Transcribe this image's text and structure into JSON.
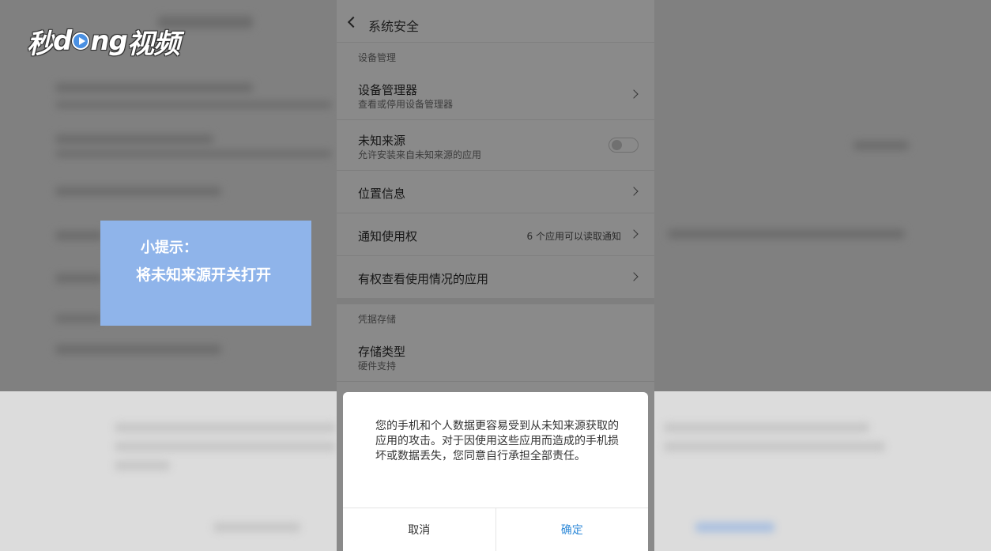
{
  "logo": {
    "prefix": "秒",
    "d": "d",
    "ng": "ng",
    "suffix": "视频"
  },
  "tip": {
    "title": "小提示：",
    "text": "将未知来源开关打开"
  },
  "header": {
    "title": "系统安全"
  },
  "sections": {
    "device_mgmt": "设备管理",
    "credential_storage": "凭据存储"
  },
  "rows": {
    "device_admin": {
      "title": "设备管理器",
      "sub": "查看或停用设备管理器"
    },
    "unknown_sources": {
      "title": "未知来源",
      "sub": "允许安装来自未知来源的应用",
      "enabled": false
    },
    "location": {
      "title": "位置信息"
    },
    "notification_access": {
      "title": "通知使用权",
      "value": "6 个应用可以读取通知"
    },
    "usage_access": {
      "title": "有权查看使用情况的应用"
    },
    "storage_type": {
      "title": "存储类型",
      "sub": "硬件支持"
    }
  },
  "dialog": {
    "message": "您的手机和个人数据更容易受到从未知来源获取的应用的攻击。对于因使用这些应用而造成的手机损坏或数据丢失，您同意自行承担全部责任。",
    "cancel": "取消",
    "ok": "确定"
  },
  "colors": {
    "tip_bg": "#8fb4ea",
    "accent": "#2f8ad8"
  }
}
